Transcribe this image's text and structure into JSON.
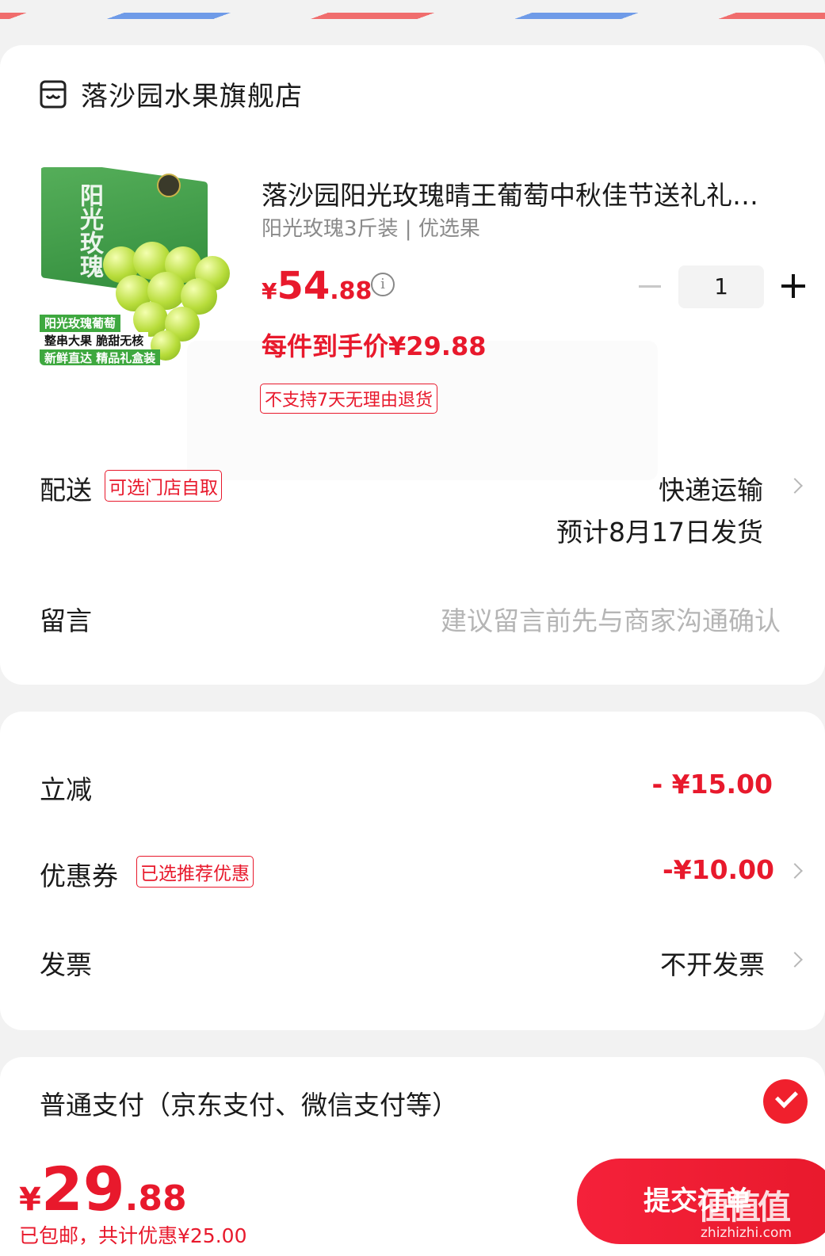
{
  "store": {
    "name": "落沙园水果旗舰店",
    "icon": "store-icon"
  },
  "product": {
    "title": "落沙园阳光玫瑰晴王葡萄中秋佳节送礼礼…",
    "spec": "阳光玫瑰3斤装 | 优选果",
    "price_symbol": "¥",
    "price_int": "54",
    "price_dec": ".88",
    "quantity": "1",
    "hand_price": "每件到手价¥29.88",
    "no_refund_tag": "不支持7天无理由退货",
    "image_tags": [
      "阳光玫瑰葡萄",
      "整串大果 脆甜无核",
      "新鲜直达 精品礼盒装"
    ],
    "box_text": "阳光玫瑰"
  },
  "delivery": {
    "label": "配送",
    "tag": "可选门店自取",
    "method": "快递运输",
    "eta": "预计8月17日发货"
  },
  "message": {
    "label": "留言",
    "placeholder": "建议留言前先与商家沟通确认"
  },
  "discounts": {
    "instant_label": "立减",
    "instant_value": "- ¥15.00",
    "coupon_label": "优惠券",
    "coupon_tag": "已选推荐优惠",
    "coupon_value": "-¥10.00",
    "invoice_label": "发票",
    "invoice_value": "不开发票"
  },
  "payment": {
    "label": "普通支付（京东支付、微信支付等）",
    "selected": true
  },
  "footer": {
    "total_symbol": "¥",
    "total_int": "29",
    "total_dec": ".88",
    "note": "已包邮，共计优惠¥25.00",
    "submit_label": "提交订单",
    "watermark": "值值值",
    "watermark_url": "zhizhizhi.com"
  },
  "colors": {
    "accent_red": "#e8192c",
    "airmail_red": "#f06d6d",
    "airmail_blue": "#6f9be8"
  }
}
